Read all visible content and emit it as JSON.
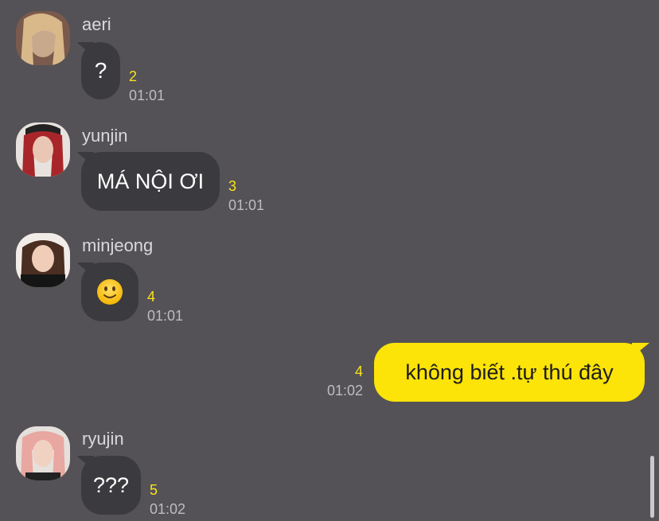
{
  "messages": [
    {
      "sender": "aeri",
      "text": "?",
      "unread": "2",
      "time": "01:01"
    },
    {
      "sender": "yunjin",
      "text": "MÁ NỘI ƠI",
      "unread": "3",
      "time": "01:01"
    },
    {
      "sender": "minjeong",
      "text": "🙂",
      "emoji": "slightly-smiling-face",
      "unread": "4",
      "time": "01:01"
    },
    {
      "sender": "me",
      "text": "không biết .tự thú đây",
      "unread": "4",
      "time": "01:02"
    },
    {
      "sender": "ryujin",
      "text": "???",
      "unread": "5",
      "time": "01:02"
    }
  ],
  "colors": {
    "background": "#545256",
    "incoming_bubble": "#3b3a3e",
    "outgoing_bubble": "#fce308",
    "unread_count": "#f8e21d"
  }
}
